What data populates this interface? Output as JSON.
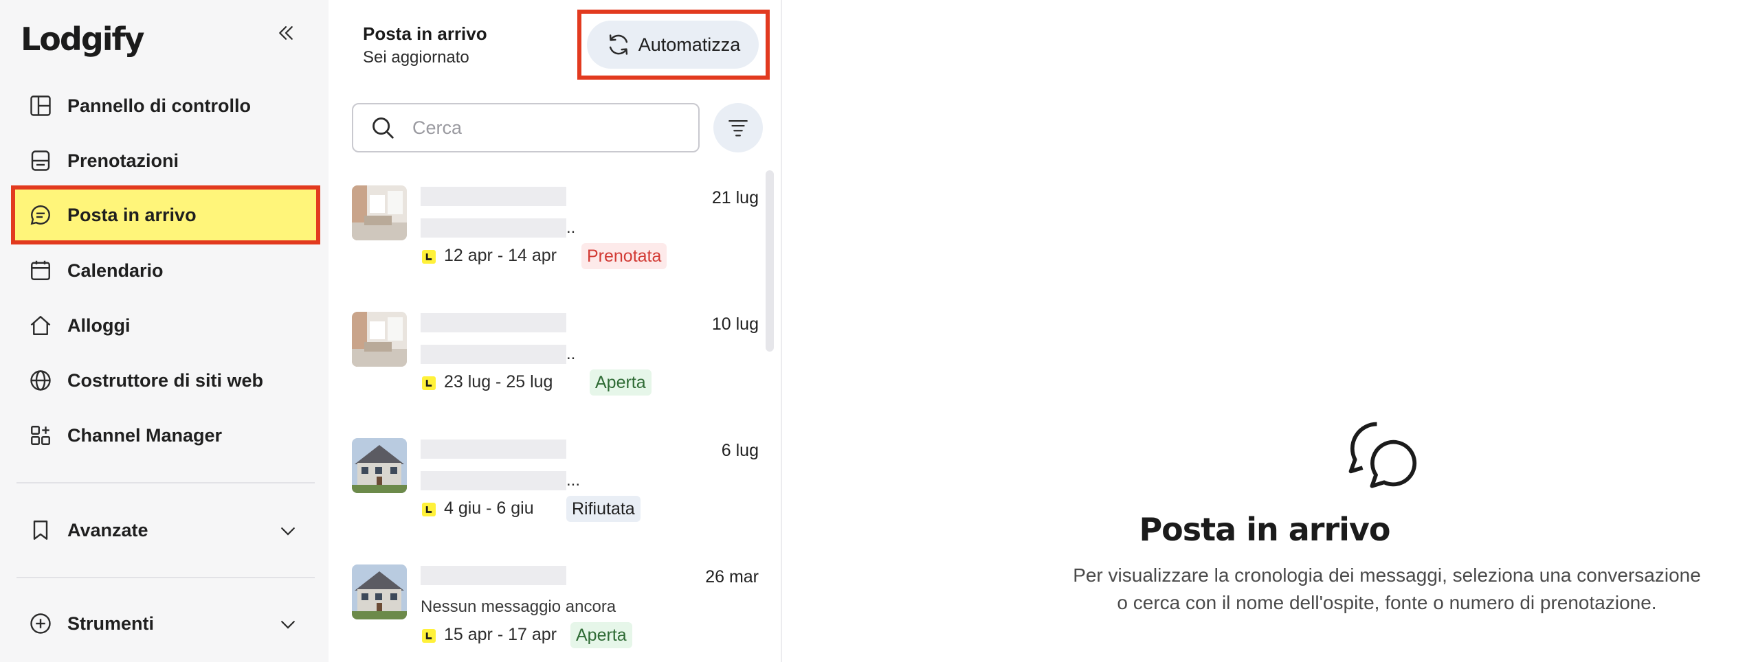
{
  "sidebar": {
    "logo": "Lodgify",
    "items": [
      {
        "label": "Pannello di controllo"
      },
      {
        "label": "Prenotazioni"
      },
      {
        "label": "Posta in arrivo"
      },
      {
        "label": "Calendario"
      },
      {
        "label": "Alloggi"
      },
      {
        "label": "Costruttore di siti web"
      },
      {
        "label": "Channel Manager"
      }
    ],
    "sections": [
      {
        "label": "Avanzate"
      },
      {
        "label": "Strumenti"
      }
    ],
    "active_color": "#fff57a",
    "highlight_color": "#e23a1f"
  },
  "inbox": {
    "title": "Posta in arrivo",
    "subtitle": "Sei aggiornato",
    "automate_label": "Automatizza",
    "search_placeholder": "Cerca",
    "conversations": [
      {
        "date": "21 lug",
        "ellipsis": "..",
        "range": "12 apr - 14 apr",
        "status": "Prenotata",
        "thumb": "interior-photo"
      },
      {
        "date": "10 lug",
        "ellipsis": "..",
        "range": "23 lug - 25 lug",
        "status": "Aperta",
        "thumb": "interior-photo"
      },
      {
        "date": "6 lug",
        "ellipsis": "...",
        "range": "4 giu - 6 giu",
        "status": "Rifiutata",
        "thumb": "house-photo"
      },
      {
        "date": "26 mar",
        "preview": "Nessun messaggio ancora",
        "range": "15 apr - 17 apr",
        "status": "Aperta",
        "thumb": "house-photo"
      }
    ]
  },
  "empty_state": {
    "icon": "chat-bubbles-icon",
    "title": "Posta in arrivo",
    "line1": "Per visualizzare la cronologia dei messaggi, seleziona una conversazione",
    "line2": "o cerca con il nome dell'ospite, fonte o numero di prenotazione."
  }
}
